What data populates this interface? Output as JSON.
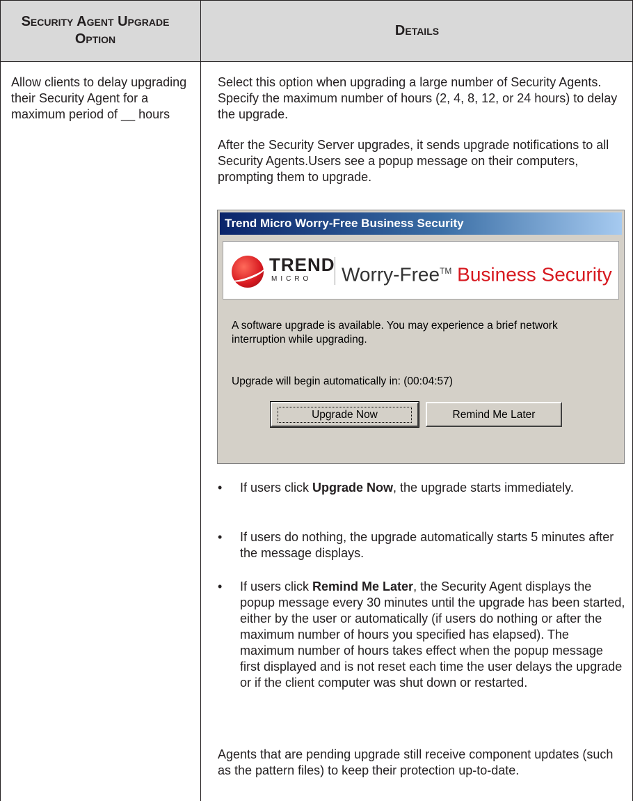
{
  "table": {
    "header_option": "Security Agent Upgrade Option",
    "header_details": "Details",
    "option_text": "Allow clients to delay upgrading their Security Agent for a maximum period of __ hours"
  },
  "details": {
    "para1": "Select this option when upgrading a large number of Security Agents. Specify the maximum number of hours (2, 4, 8, 12, or 24 hours) to delay the upgrade.",
    "para2": "After the Security Server upgrades, it sends upgrade notifications to all Security Agents.Users see a popup message on their computers, prompting them to upgrade.",
    "bullet_symbol": "•",
    "bullet1_pre": "If users click ",
    "bullet1_bold": "Upgrade Now",
    "bullet1_post": ", the upgrade starts immediately.",
    "bullet2": "If users do nothing, the upgrade automatically starts 5 minutes after the message displays.",
    "bullet3_pre": "If users click ",
    "bullet3_bold": "Remind Me Later",
    "bullet3_post": ", the Security Agent displays the popup message every 30 minutes until the upgrade has been started, either by the user or automatically (if users do nothing or after the maximum number of hours you specified has elapsed). The maximum number of hours takes effect when the popup message first displayed and is not reset each time the user delays the upgrade or if the client computer was shut down or restarted.",
    "para_last": "Agents that are pending upgrade still receive component updates (such as the pattern files) to keep their protection up-to-date."
  },
  "dialog": {
    "title": "Trend Micro Worry-Free Business Security",
    "brand_big": "TREND",
    "brand_small": "MICRO",
    "product_a": "Worry-Free",
    "product_tm": "TM",
    "product_b": "Business Security",
    "message": "A software upgrade is available.  You may experience a brief network interruption while upgrading.",
    "countdown": "Upgrade will begin automatically in:   (00:04:57)",
    "upgrade_button": "Upgrade Now",
    "remind_button": "Remind Me Later"
  },
  "colors": {
    "header_bg": "#d9d9d9",
    "brand_red": "#d71920",
    "dialog_bg": "#d4d0c8",
    "titlebar": "#0a246a"
  }
}
